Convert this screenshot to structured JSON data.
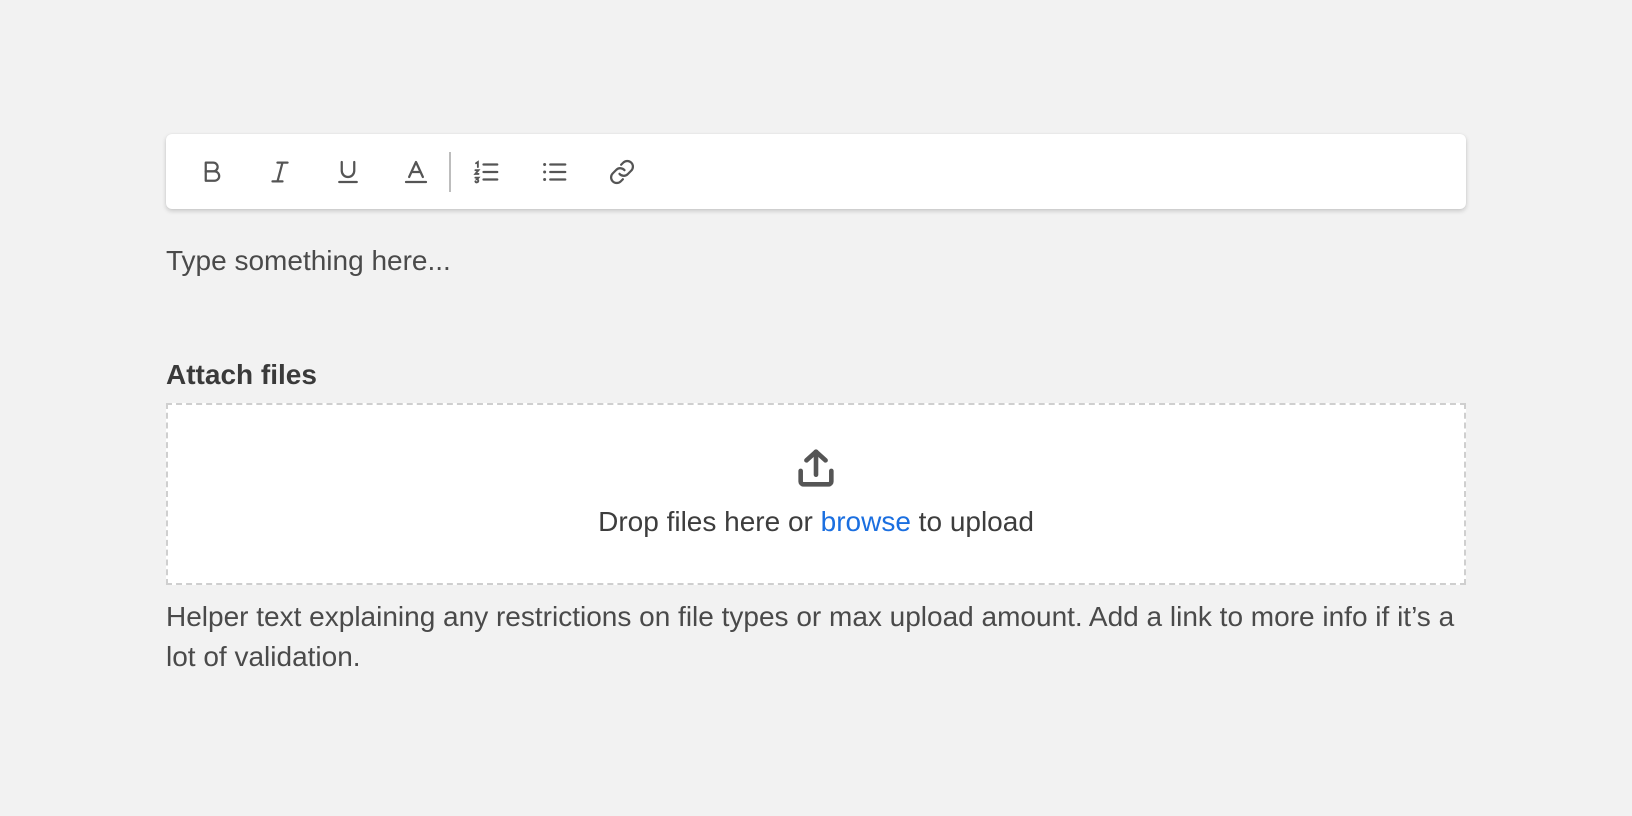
{
  "toolbar": {
    "buttons": [
      {
        "icon": "bold-icon",
        "label": "Bold"
      },
      {
        "icon": "italic-icon",
        "label": "Italic"
      },
      {
        "icon": "underline-icon",
        "label": "Underline"
      },
      {
        "icon": "text-color-icon",
        "label": "Text color"
      },
      {
        "icon": "numbered-list-icon",
        "label": "Numbered list"
      },
      {
        "icon": "bulleted-list-icon",
        "label": "Bulleted list"
      },
      {
        "icon": "link-icon",
        "label": "Link"
      }
    ]
  },
  "editor": {
    "placeholder": "Type something here...",
    "value": ""
  },
  "attachments": {
    "label": "Attach files",
    "upload_icon": "upload-icon",
    "drop_text_before": "Drop files here or ",
    "browse_link": "browse",
    "drop_text_after": " to upload",
    "helper_text": "Helper text explaining any restrictions on file types or max upload amount. Add a link to more info if it’s a lot of validation."
  },
  "colors": {
    "background": "#f2f2f2",
    "link": "#1b6fe0",
    "icon": "#555555",
    "text": "#3d3d3d",
    "dropzone_border": "#cfcfcf"
  }
}
